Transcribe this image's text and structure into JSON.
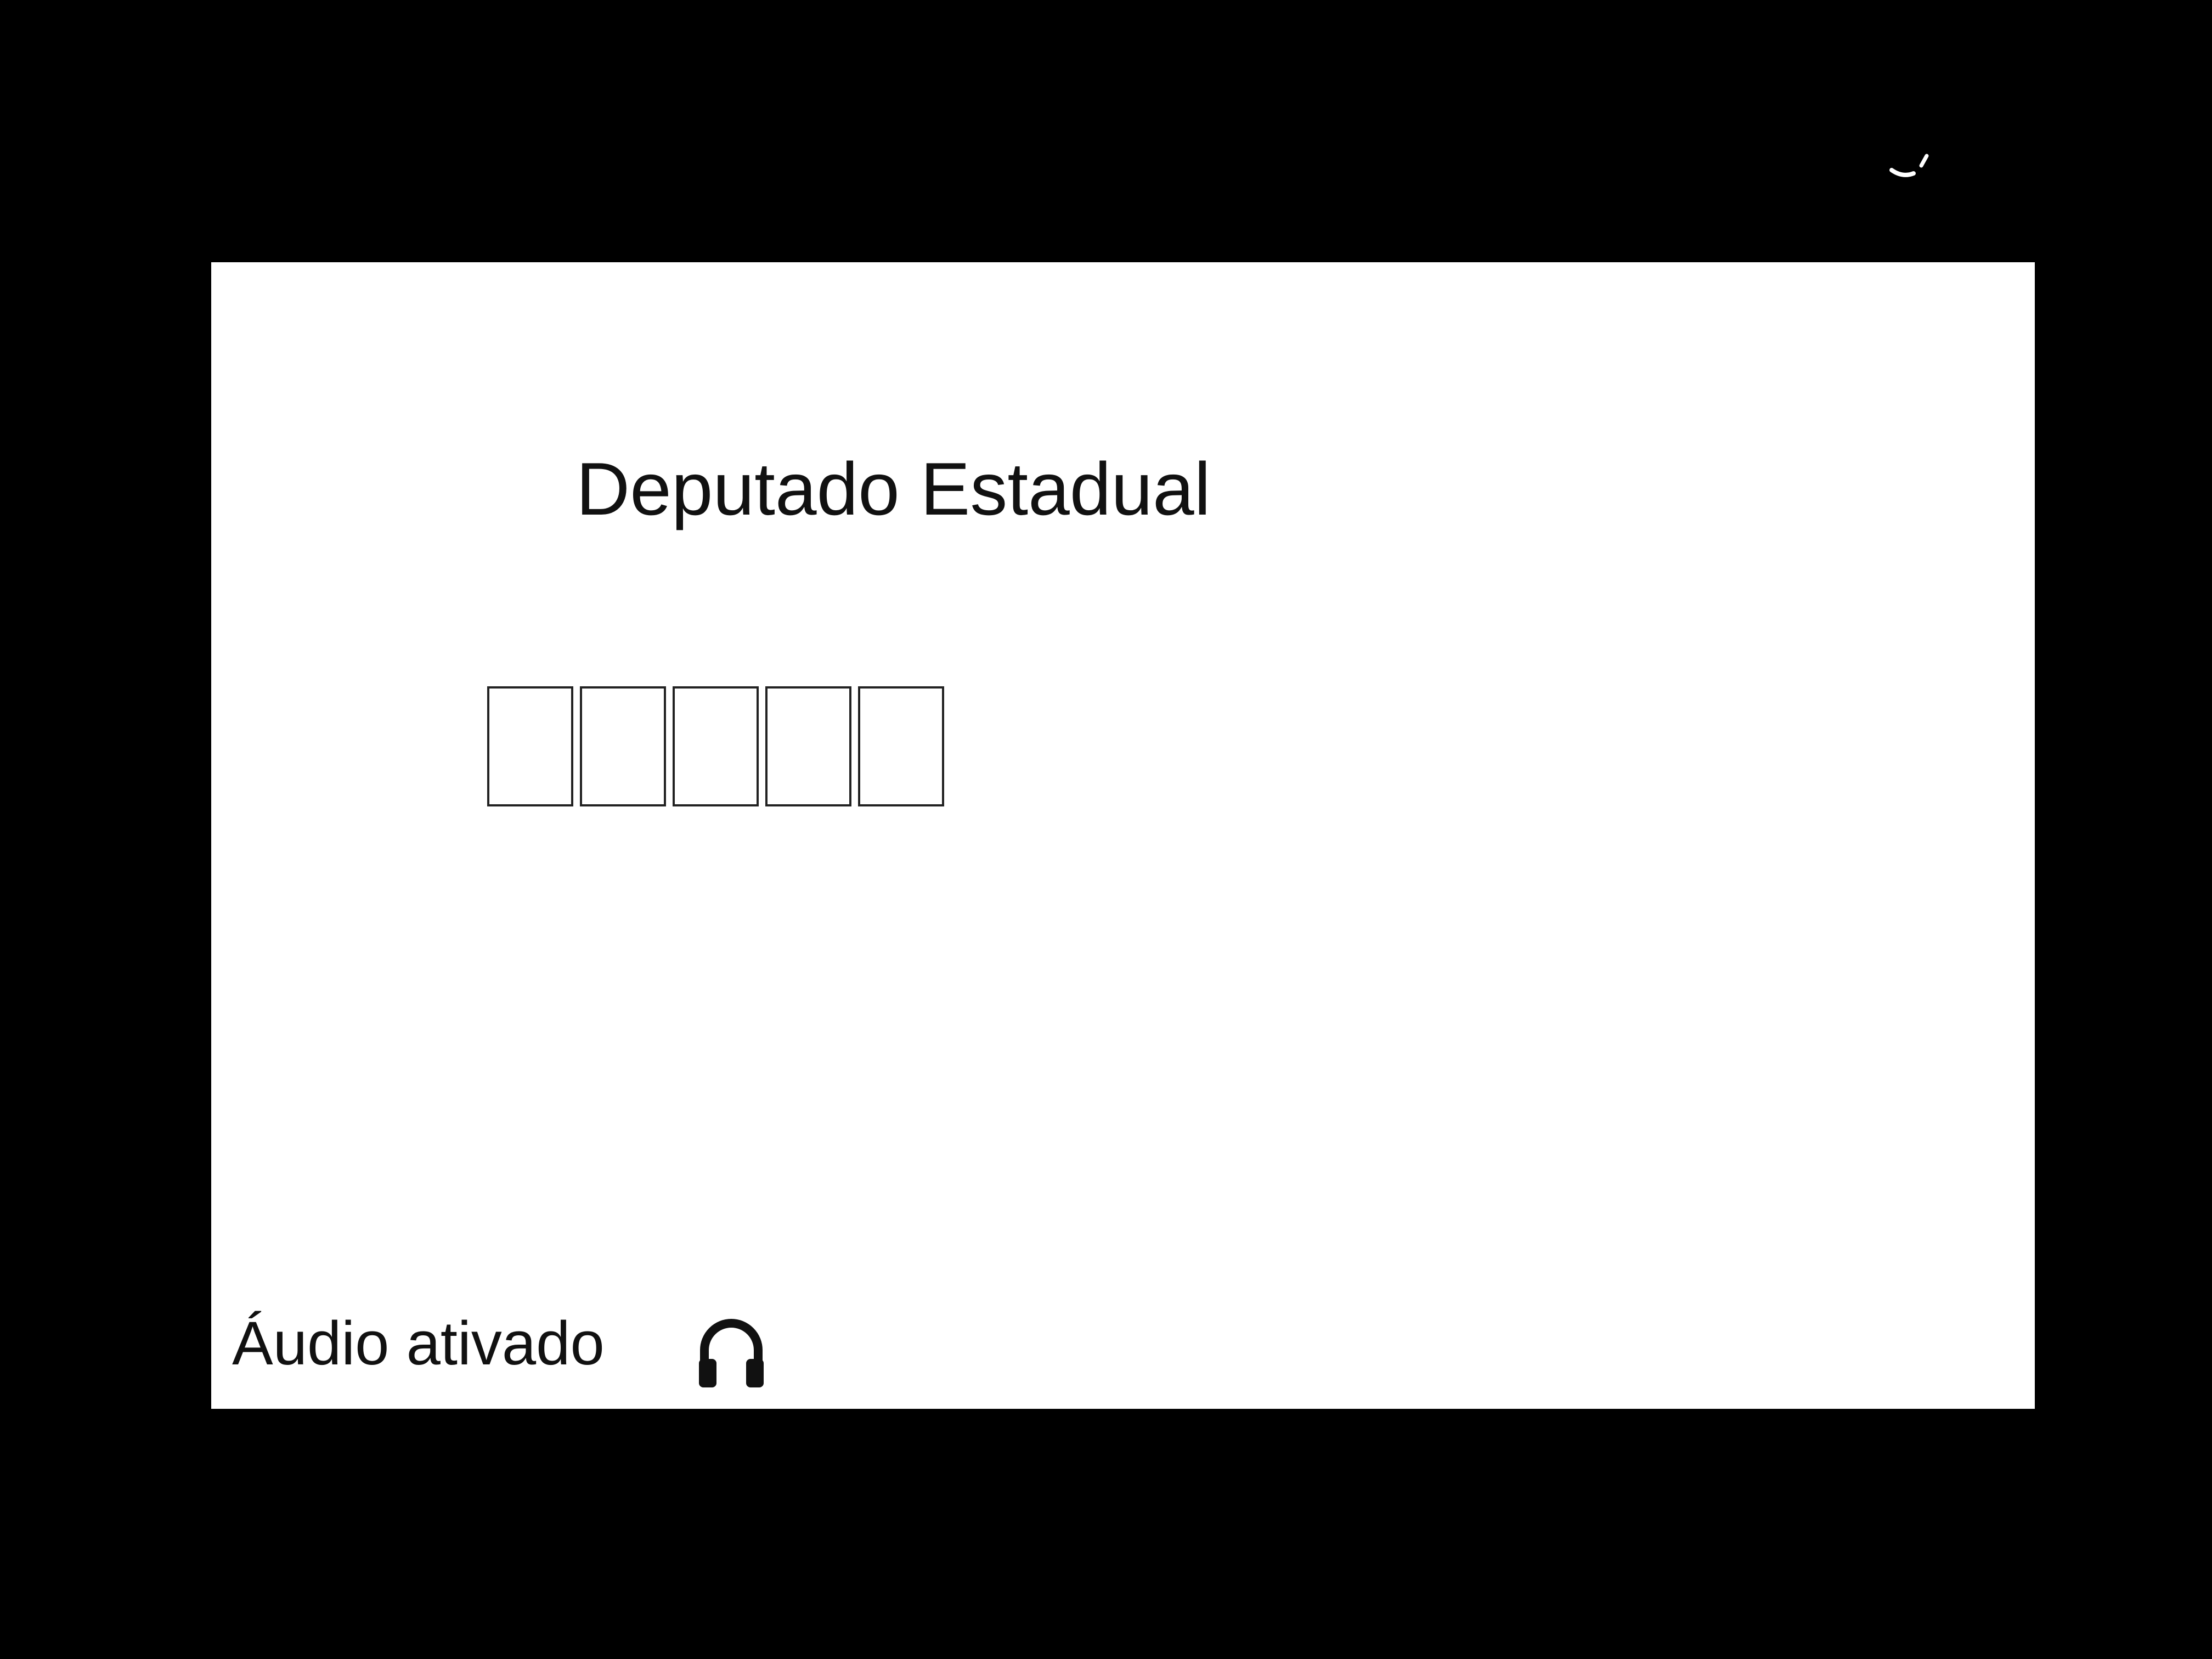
{
  "ballot_screen": {
    "office_title": "Deputado Estadual",
    "candidate_number_digits": [
      "",
      "",
      "",
      "",
      ""
    ],
    "audio_status": "Áudio ativado",
    "audio_icon": "headphones-icon"
  },
  "colors": {
    "background": "#000000",
    "screen": "#ffffff",
    "text": "#111111"
  }
}
